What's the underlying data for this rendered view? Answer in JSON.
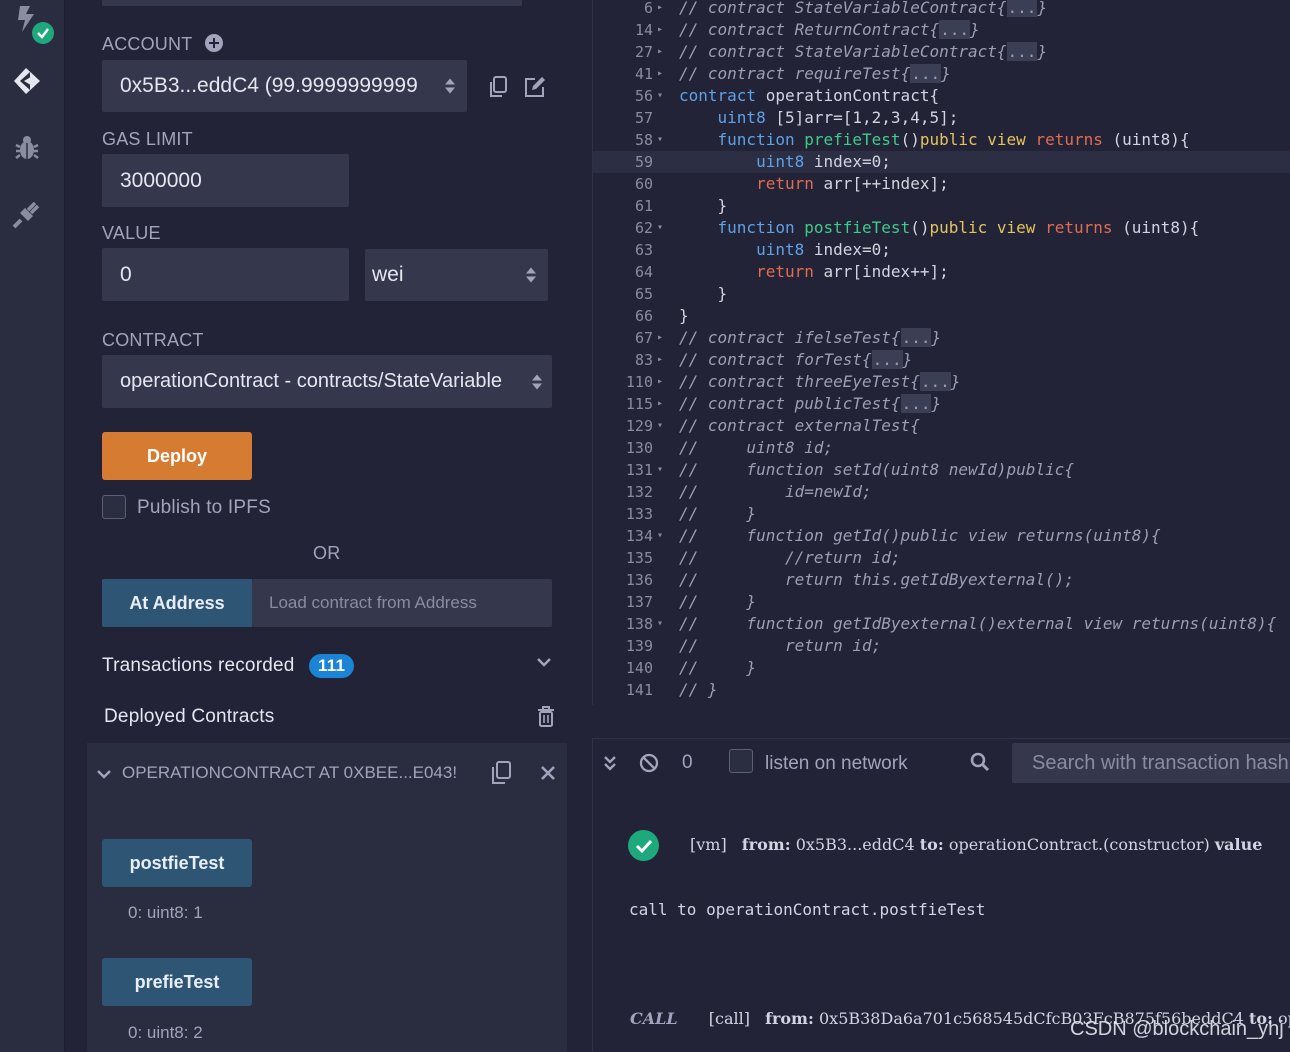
{
  "rail": {
    "icons": [
      "compiler-icon",
      "deploy-run-icon",
      "debugger-icon",
      "plugin-manager-icon"
    ]
  },
  "run": {
    "account_label": "ACCOUNT",
    "account_value": "0x5B3...eddC4 (99.9999999999",
    "gas_limit_label": "GAS LIMIT",
    "gas_limit_value": "3000000",
    "value_label": "VALUE",
    "value_amount": "0",
    "value_unit": "wei",
    "contract_label": "CONTRACT",
    "contract_value": "operationContract - contracts/StateVariable",
    "deploy_label": "Deploy",
    "publish_ipfs_label": "Publish to IPFS",
    "publish_ipfs_checked": false,
    "or_label": "OR",
    "at_address_label": "At Address",
    "load_address_placeholder": "Load contract from Address",
    "transactions_label": "Transactions recorded",
    "transactions_count": "111",
    "deployed_label": "Deployed Contracts",
    "instance_title": "OPERATIONCONTRACT AT 0XBEE...E043!",
    "functions": [
      {
        "name": "postfieTest",
        "output": "0: uint8: 1"
      },
      {
        "name": "prefieTest",
        "output": "0: uint8: 2"
      }
    ]
  },
  "editor": {
    "current_line": "59",
    "lines": [
      {
        "n": "6",
        "fold": "▸"
      },
      {
        "n": "14",
        "fold": "▸"
      },
      {
        "n": "27",
        "fold": "▸"
      },
      {
        "n": "41",
        "fold": "▸"
      },
      {
        "n": "56",
        "fold": "▾"
      },
      {
        "n": "57",
        "fold": ""
      },
      {
        "n": "58",
        "fold": "▾"
      },
      {
        "n": "59",
        "fold": ""
      },
      {
        "n": "60",
        "fold": ""
      },
      {
        "n": "61",
        "fold": ""
      },
      {
        "n": "62",
        "fold": "▾"
      },
      {
        "n": "63",
        "fold": ""
      },
      {
        "n": "64",
        "fold": ""
      },
      {
        "n": "65",
        "fold": ""
      },
      {
        "n": "66",
        "fold": ""
      },
      {
        "n": "67",
        "fold": "▸"
      },
      {
        "n": "83",
        "fold": "▸"
      },
      {
        "n": "110",
        "fold": "▸"
      },
      {
        "n": "115",
        "fold": "▸"
      },
      {
        "n": "129",
        "fold": "▾"
      },
      {
        "n": "130",
        "fold": ""
      },
      {
        "n": "131",
        "fold": "▾"
      },
      {
        "n": "132",
        "fold": ""
      },
      {
        "n": "133",
        "fold": ""
      },
      {
        "n": "134",
        "fold": "▾"
      },
      {
        "n": "135",
        "fold": ""
      },
      {
        "n": "136",
        "fold": ""
      },
      {
        "n": "137",
        "fold": ""
      },
      {
        "n": "138",
        "fold": "▾"
      },
      {
        "n": "139",
        "fold": ""
      },
      {
        "n": "140",
        "fold": ""
      },
      {
        "n": "141",
        "fold": ""
      }
    ],
    "code": {
      "l6": "// contract StateVariableContract",
      "l14": "// contract ReturnContract",
      "l27": "// contract StateVariableContract",
      "l41": "// contract requireTest",
      "l56_kw": "contract",
      "l56_rest": " operationContract{",
      "l57_type": "uint8",
      "l57_rest": " [5]arr=[1,2,3,4,5];",
      "l58_kw": "function",
      "l58_name": "prefieTest",
      "l58_paren": "()",
      "l58_mod": "public view",
      "l58_ret": "returns",
      "l58_tail": " (uint8){",
      "l59_type": "uint8",
      "l59_rest": " index=0;",
      "l60_ret": "return",
      "l60_rest": " arr[++index];",
      "l61": "}",
      "l62_kw": "function",
      "l62_name": "postfieTest",
      "l62_paren": "()",
      "l62_mod": "public view",
      "l62_ret": "returns",
      "l62_tail": " (uint8){",
      "l63_type": "uint8",
      "l63_rest": " index=0;",
      "l64_ret": "return",
      "l64_rest": " arr[index++];",
      "l65": "}",
      "l66": "}",
      "l67": "// contract ifelseTest",
      "l83": "// contract forTest",
      "l110": "// contract threeEyeTest",
      "l115": "// contract publicTest",
      "l129": "// contract externalTest{",
      "l130": "//     uint8 id;",
      "l131": "//     function setId(uint8 newId)public{",
      "l132": "//         id=newId;",
      "l133": "//     }",
      "l134": "//     function getId()public view returns(uint8){",
      "l135": "//         //return id;",
      "l136": "//         return this.getIdByexternal();",
      "l137": "//     }",
      "l138": "//     function getIdByexternal()external view returns(uint8){",
      "l139": "//         return id;",
      "l140": "//     }",
      "l141": "// }",
      "elided": "...",
      "close_brace": "}"
    }
  },
  "terminal": {
    "pending_count": "0",
    "listen_label": "listen on network",
    "search_placeholder": "Search with transaction hash",
    "tx1_tag": "[vm]",
    "tx1_from_label": "from:",
    "tx1_from": "0x5B3...eddC4",
    "tx1_to_label": "to:",
    "tx1_to": "operationContract.(constructor)",
    "tx1_value_label": "value",
    "call_text": "call to operationContract.postfieTest",
    "call_tag": "CALL",
    "call_kind": "[call]",
    "call_from_label": "from:",
    "call_from": "0x5B38Da6a701c568545dCfcB03FcB875f56beddC4",
    "call_to_label": "to:",
    "call_to": "opera"
  },
  "watermark": "CSDN @blockchain_yhj"
}
